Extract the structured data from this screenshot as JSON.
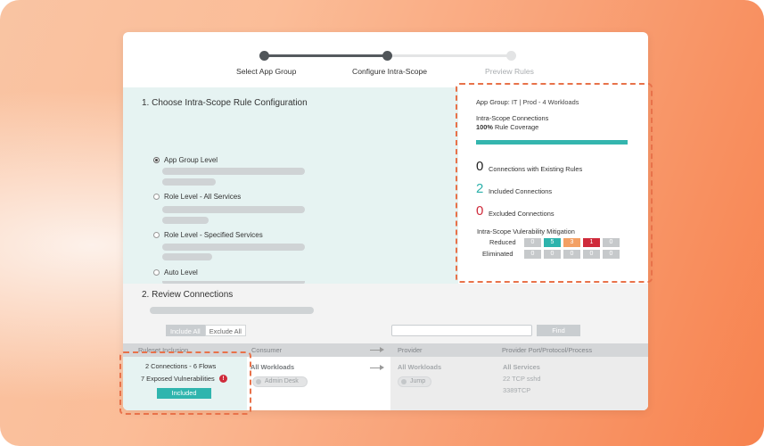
{
  "stepper": {
    "steps": [
      {
        "label": "Select App Group",
        "state": "done"
      },
      {
        "label": "Configure Intra-Scope",
        "state": "current"
      },
      {
        "label": "Preview Rules",
        "state": "todo"
      }
    ]
  },
  "config": {
    "title": "1. Choose Intra-Scope Rule Configuration",
    "options": [
      {
        "label": "App Group Level",
        "checked": true
      },
      {
        "label": "Role Level - All Services",
        "checked": false
      },
      {
        "label": "Role Level - Specified Services",
        "checked": false
      },
      {
        "label": "Auto Level",
        "checked": false
      }
    ]
  },
  "summary": {
    "app_group_label": "App Group:",
    "app_group_value": "IT | Prod - 4 Workloads",
    "connections_title": "Intra-Scope Connections",
    "coverage_pct": "100%",
    "coverage_label": "Rule Coverage",
    "coverage_fraction": 1.0,
    "existing_count": "0",
    "existing_label": "Connections with Existing Rules",
    "included_count": "2",
    "included_label": "Included Connections",
    "excluded_count": "0",
    "excluded_label": "Excluded Connections",
    "vuln_title": "Intra-Scope Vulerability Mitigation",
    "reduced_label": "Reduced",
    "reduced_values": [
      "0",
      "5",
      "3",
      "1",
      "0"
    ],
    "eliminated_label": "Eliminated",
    "eliminated_values": [
      "0",
      "0",
      "0",
      "0",
      "0"
    ]
  },
  "review": {
    "title": "2. Review Connections",
    "include_all": "Include All",
    "exclude_all": "Exclude All",
    "search_placeholder": "",
    "find": "Find",
    "columns": {
      "ruleset": "Ruleset Inclusion",
      "consumer": "Consumer",
      "provider": "Provider",
      "port": "Provider Port/Protocol/Process"
    },
    "row": {
      "connections": "2 Connections - 6 Flows",
      "vulns": "7 Exposed Vulnerabilities",
      "status": "Included",
      "consumer": "All Workloads",
      "consumer_tag": "Admin Desk",
      "provider": "All Workloads",
      "provider_tag": "Jump",
      "service": "All Services",
      "port1": "22 TCP sshd",
      "port2": "3389TCP"
    }
  },
  "colors": {
    "teal": "#2db3ac",
    "red": "#cf2b3b",
    "orange": "#f3a064",
    "highlight_dash": "#e8724a"
  }
}
